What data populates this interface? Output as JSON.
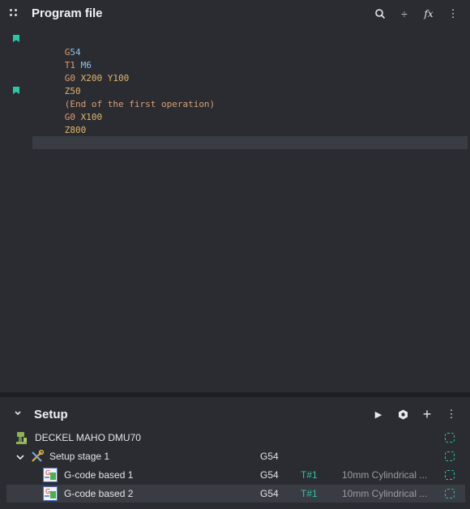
{
  "program_panel": {
    "title": "Program file",
    "tools": [
      {
        "name": "search-icon",
        "glyph": "⚲"
      },
      {
        "name": "divide-icon",
        "glyph": "÷"
      },
      {
        "name": "function-icon",
        "glyph": "fx"
      },
      {
        "name": "more-vertical-icon",
        "glyph": "⋮"
      }
    ],
    "code_lines": [
      [
        "G",
        "54"
      ],
      [
        "T1 ",
        "M6"
      ],
      [
        "G0 ",
        "X200 ",
        "Y100"
      ],
      [
        "Z50"
      ],
      [
        "(End of the first operation)"
      ],
      [
        "G0 ",
        "X100"
      ],
      [
        "Z800"
      ]
    ]
  },
  "setup_panel": {
    "title": "Setup",
    "tools": [
      {
        "name": "play-icon",
        "glyph": "▶"
      },
      {
        "name": "settings-icon",
        "glyph": "⬢"
      },
      {
        "name": "add-icon",
        "glyph": "+"
      },
      {
        "name": "more-vertical-icon",
        "glyph": "⋮"
      }
    ],
    "machine": {
      "label": "DECKEL MAHO DMU70"
    },
    "stage": {
      "label": "Setup stage 1",
      "gcode": "G54"
    },
    "operations": [
      {
        "label": "G-code based 1",
        "gcode": "G54",
        "tool_no": "T#1",
        "tool": "10mm Cylindrical ..."
      },
      {
        "label": "G-code based 2",
        "gcode": "G54",
        "tool_no": "T#1",
        "tool": "10mm Cylindrical ..."
      }
    ]
  },
  "colors": {
    "accent": "#2ec4a6",
    "panel_bg": "#2a2c32",
    "selection_bg": "#3a3c43"
  }
}
